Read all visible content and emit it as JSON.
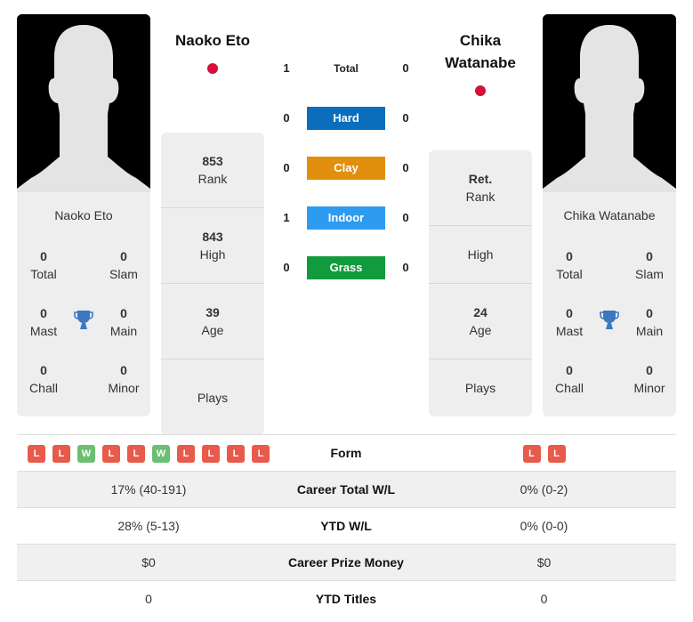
{
  "player1": {
    "name": "Naoko Eto",
    "card_name": "Naoko Eto",
    "flag_color": "#d5103a",
    "titles": {
      "total": {
        "value": "0",
        "label": "Total"
      },
      "slam": {
        "value": "0",
        "label": "Slam"
      },
      "mast": {
        "value": "0",
        "label": "Mast"
      },
      "main": {
        "value": "0",
        "label": "Main"
      },
      "chall": {
        "value": "0",
        "label": "Chall"
      },
      "minor": {
        "value": "0",
        "label": "Minor"
      }
    },
    "stats": {
      "rank": {
        "value": "853",
        "label": "Rank"
      },
      "high": {
        "value": "843",
        "label": "High"
      },
      "age": {
        "value": "39",
        "label": "Age"
      },
      "plays": {
        "value": "",
        "label": "Plays"
      }
    }
  },
  "player2": {
    "name_line1": "Chika",
    "name_line2": "Watanabe",
    "card_name": "Chika Watanabe",
    "flag_color": "#d5103a",
    "titles": {
      "total": {
        "value": "0",
        "label": "Total"
      },
      "slam": {
        "value": "0",
        "label": "Slam"
      },
      "mast": {
        "value": "0",
        "label": "Mast"
      },
      "main": {
        "value": "0",
        "label": "Main"
      },
      "chall": {
        "value": "0",
        "label": "Chall"
      },
      "minor": {
        "value": "0",
        "label": "Minor"
      }
    },
    "stats": {
      "rank": {
        "value": "Ret.",
        "label": "Rank"
      },
      "high": {
        "value": "",
        "label": "High"
      },
      "age": {
        "value": "24",
        "label": "Age"
      },
      "plays": {
        "value": "",
        "label": "Plays"
      }
    }
  },
  "h2h": {
    "total": {
      "label": "Total",
      "p1": "1",
      "p2": "0"
    },
    "surfaces": [
      {
        "label": "Hard",
        "p1": "0",
        "p2": "0",
        "color": "#0a6ebd"
      },
      {
        "label": "Clay",
        "p1": "0",
        "p2": "0",
        "color": "#e0900c"
      },
      {
        "label": "Indoor",
        "p1": "1",
        "p2": "0",
        "color": "#2d9cf0"
      },
      {
        "label": "Grass",
        "p1": "0",
        "p2": "0",
        "color": "#119b3c"
      }
    ]
  },
  "comparison": {
    "form": {
      "label": "Form",
      "p1": [
        "L",
        "L",
        "W",
        "L",
        "L",
        "W",
        "L",
        "L",
        "L",
        "L"
      ],
      "p2": [
        "L",
        "L"
      ]
    },
    "rows": [
      {
        "label": "Career Total W/L",
        "p1": "17% (40-191)",
        "p2": "0% (0-2)"
      },
      {
        "label": "YTD W/L",
        "p1": "28% (5-13)",
        "p2": "0% (0-0)"
      },
      {
        "label": "Career Prize Money",
        "p1": "$0",
        "p2": "$0"
      },
      {
        "label": "YTD Titles",
        "p1": "0",
        "p2": "0"
      }
    ]
  }
}
